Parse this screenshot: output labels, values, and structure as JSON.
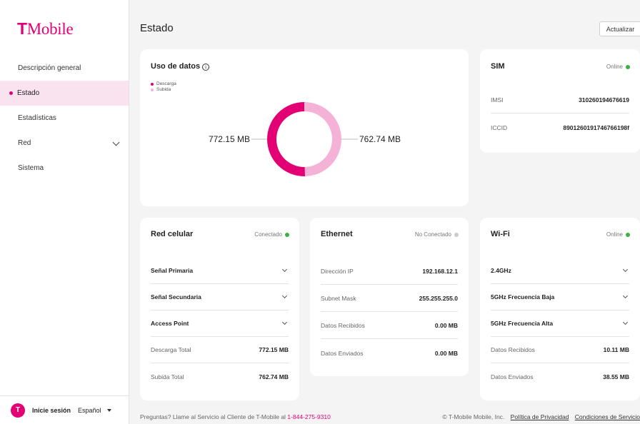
{
  "brand": {
    "logo_text": "Mobile",
    "logo_tee": "T",
    "accent": "#e20074",
    "accent_light": "#f4b3d6"
  },
  "sidebar": {
    "items": [
      {
        "label": "Descripción general"
      },
      {
        "label": "Estado",
        "active": true
      },
      {
        "label": "Estadísticas"
      },
      {
        "label": "Red"
      },
      {
        "label": "Sistema"
      }
    ],
    "footer": {
      "avatar": "T",
      "login": "Inicie sesión",
      "language": "Español"
    }
  },
  "header": {
    "title": "Estado",
    "refresh_label": "Actualizar"
  },
  "data_usage": {
    "title": "Uso de datos",
    "legend": {
      "download": "Descarga",
      "upload": "Subida"
    },
    "download_value": "772.15 MB",
    "upload_value": "762.74 MB",
    "download_mb": 772.15,
    "upload_mb": 762.74
  },
  "sim": {
    "title": "SIM",
    "status": "Online",
    "rows": [
      {
        "label": "IMSI",
        "value": "310260194676619"
      },
      {
        "label": "ICCID",
        "value": "8901260191746766198f"
      }
    ]
  },
  "cellular": {
    "title": "Red celular",
    "status": "Conectado",
    "rows": [
      {
        "label": "Señal Primaria"
      },
      {
        "label": "Señal Secundaria"
      },
      {
        "label": "Access Point"
      },
      {
        "label": "Descarga Total",
        "value": "772.15 MB"
      },
      {
        "label": "Subida Total",
        "value": "762.74 MB"
      }
    ]
  },
  "ethernet": {
    "title": "Ethernet",
    "status": "No Conectado",
    "rows": [
      {
        "label": "Dirección IP",
        "value": "192.168.12.1"
      },
      {
        "label": "Subnet Mask",
        "value": "255.255.255.0"
      },
      {
        "label": "Datos Recibidos",
        "value": "0.00 MB"
      },
      {
        "label": "Datos Enviados",
        "value": "0.00 MB"
      }
    ]
  },
  "wifi": {
    "title": "Wi-Fi",
    "status": "Online",
    "rows": [
      {
        "label": "2.4GHz"
      },
      {
        "label": "5GHz Frecuencia Baja"
      },
      {
        "label": "5GHz Frecuencia Alta"
      },
      {
        "label": "Datos Recibidos",
        "value": "10.11 MB"
      },
      {
        "label": "Datos Enviados",
        "value": "38.55 MB"
      }
    ]
  },
  "footer": {
    "question": "Preguntas? Llame al Servicio al Cliente de T-Mobile al",
    "phone": "1-844-275-9310",
    "copyright": "© T-Mobile Mobile, Inc.",
    "privacy": "Política de Privacidad",
    "terms": "Condiciones de Servicio"
  },
  "colors": {
    "online": "#3cb043",
    "offline": "#cccccc"
  }
}
